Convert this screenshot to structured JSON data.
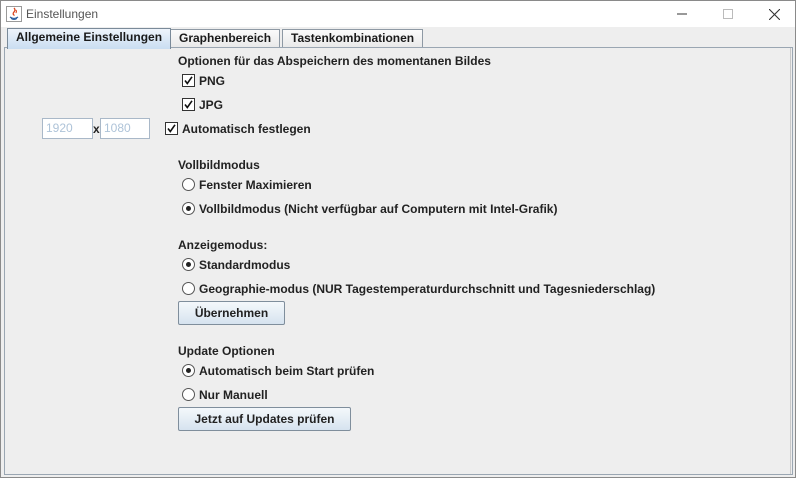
{
  "window": {
    "title": "Einstellungen"
  },
  "tabs": [
    {
      "label": "Allgemeine Einstellungen",
      "active": true
    },
    {
      "label": "Graphenbereich",
      "active": false
    },
    {
      "label": "Tastenkombinationen",
      "active": false
    }
  ],
  "export": {
    "heading": "Optionen für das Abspeichern des momentanen Bildes",
    "png_label": "PNG",
    "jpg_label": "JPG",
    "png_checked": true,
    "jpg_checked": true,
    "width_value": "1920",
    "height_value": "1080",
    "times_label": "x",
    "auto_label": "Automatisch festlegen",
    "auto_checked": true
  },
  "fullscreen": {
    "heading": "Vollbildmodus",
    "options": [
      {
        "label": "Fenster Maximieren",
        "selected": false
      },
      {
        "label": "Vollbildmodus (Nicht verfügbar auf Computern mit Intel-Grafik)",
        "selected": true
      }
    ]
  },
  "display": {
    "heading": "Anzeigemodus:",
    "options": [
      {
        "label": "Standardmodus",
        "selected": true
      },
      {
        "label": "Geographie-modus (NUR Tagestemperaturdurchschnitt und Tagesniederschlag)",
        "selected": false
      }
    ],
    "apply_label": "Übernehmen"
  },
  "updates": {
    "heading": "Update Optionen",
    "options": [
      {
        "label": "Automatisch beim Start prüfen",
        "selected": true
      },
      {
        "label": "Nur Manuell",
        "selected": false
      }
    ],
    "check_label": "Jetzt auf Updates prüfen"
  }
}
